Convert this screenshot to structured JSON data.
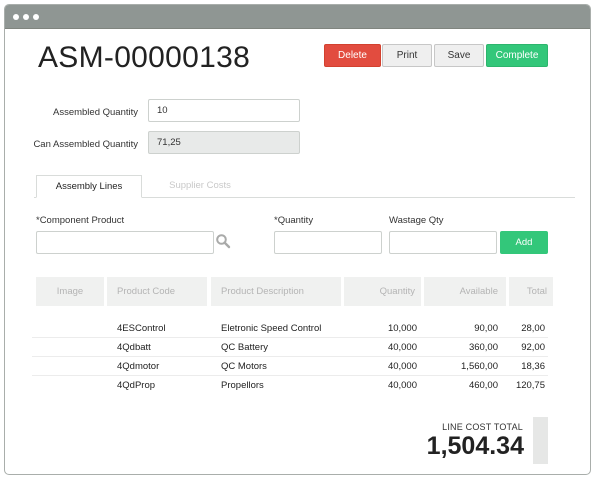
{
  "title": "ASM-00000138",
  "actions": {
    "delete": "Delete",
    "print": "Print",
    "save": "Save",
    "complete": "Complete"
  },
  "form": {
    "assembled_quantity_label": "Assembled Quantity",
    "assembled_quantity_value": "10",
    "can_assembled_quantity_label": "Can Assembled Quantity",
    "can_assembled_quantity_value": "71,25"
  },
  "tabs": [
    "Assembly Lines",
    "Supplier Costs"
  ],
  "add_line": {
    "component_label": "*Component Product",
    "quantity_label": "*Quantity",
    "wastage_label": "Wastage Qty",
    "add_button": "Add"
  },
  "table": {
    "headers": [
      "Image",
      "Product Code",
      "Product Description",
      "Quantity",
      "Available",
      "Total"
    ],
    "rows": [
      [
        "",
        "4ESControl",
        "Eletronic Speed Control",
        "10,000",
        "90,00",
        "28,00"
      ],
      [
        "",
        "4Qdbatt",
        "QC Battery",
        "40,000",
        "360,00",
        "92,00"
      ],
      [
        "",
        "4Qdmotor",
        "QC Motors",
        "40,000",
        "1,560,00",
        "18,36"
      ],
      [
        "",
        "4QdProp",
        "Propellors",
        "40,000",
        "460,00",
        "120,75"
      ]
    ]
  },
  "totals": {
    "label": "LINE COST TOTAL",
    "value": "1,504.34"
  },
  "colors": {
    "danger": "#e24c3f",
    "success": "#33c77a",
    "titlebar": "#8f9693"
  },
  "icons": {
    "search": "magnifier"
  }
}
